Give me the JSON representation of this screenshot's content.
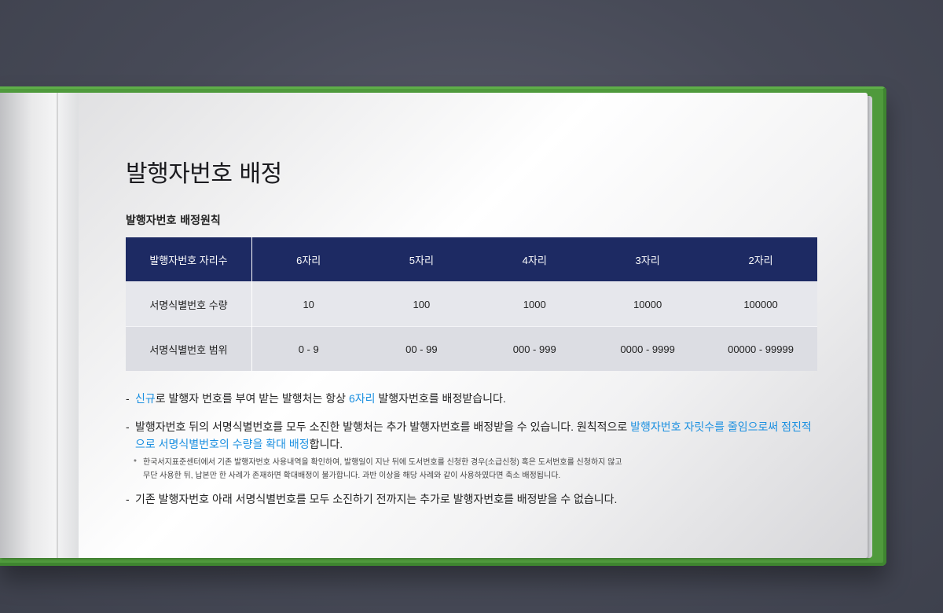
{
  "title": "발행자번호 배정",
  "subtitle": "발행자번호 배정원칙",
  "table": {
    "header": [
      "발행자번호 자리수",
      "6자리",
      "5자리",
      "4자리",
      "3자리",
      "2자리"
    ],
    "rows": [
      [
        "서명식별번호 수량",
        "10",
        "100",
        "1000",
        "10000",
        "100000"
      ],
      [
        "서명식별번호 범위",
        "0 - 9",
        "00 - 99",
        "000 - 999",
        "0000 - 9999",
        "00000 - 99999"
      ]
    ]
  },
  "notes": {
    "n1": {
      "dash": "-",
      "a": "신규",
      "b": "로 발행자 번호를 부여 받는 발행처는 항상 ",
      "c": "6자리",
      "d": " 발행자번호를 배정받습니다."
    },
    "n2": {
      "dash": "-",
      "a": "발행자번호 뒤의 서명식별번호를 모두 소진한 발행처는 추가 발행자번호를 배정받을 수 있습니다.  원칙적으로 ",
      "b": "발행자번호 자릿수를 줄임으로써 점진적으로 서명식별번호의 수량을 확대 배정",
      "c": "합니다."
    },
    "sub": {
      "star": "*",
      "line1": "한국서지표준센터에서 기존 발행자번호 사용내역을 확인하여, 발행일이 지난 뒤에 도서번호를 신청한 경우(소급신청) 혹은 도서번호를 신청하지 않고",
      "line2": "무단 사용한 뒤, 납본만 한 사례가 존재하면 확대배정이 불가합니다. 과반 이상을 해당 사례와 같이 사용하였다면 축소 배정됩니다."
    },
    "n3": {
      "dash": "-",
      "text": "기존 발행자번호 아래 서명식별번호를 모두 소진하기 전까지는 추가로 발행자번호를 배정받을 수 없습니다."
    }
  },
  "colors": {
    "header_bg": "#1d2a63",
    "highlight": "#1a8fe0",
    "cover": "#4f9a3c"
  }
}
